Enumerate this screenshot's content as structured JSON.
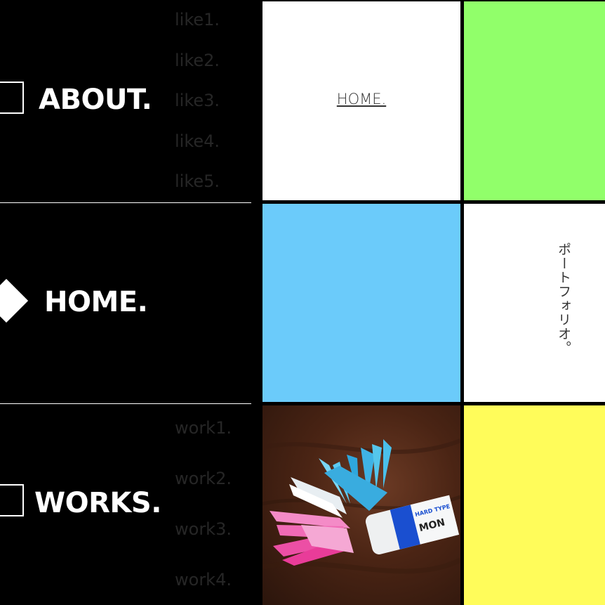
{
  "colors": {
    "background": "#000000",
    "nav_text": "#ffffff",
    "sub_text": "#262626",
    "green_tile": "#91ff6a",
    "blue_tile": "#6bcbfa",
    "yellow_tile": "#fffc5a",
    "white_tile": "#ffffff"
  },
  "nav": {
    "about": {
      "label": "ABOUT.",
      "icon": "square-outline-icon",
      "items": [
        "like1.",
        "like2.",
        "like3.",
        "like4.",
        "like5."
      ]
    },
    "home": {
      "label": "HOME.",
      "icon": "diamond-icon"
    },
    "works": {
      "label": "WORKS.",
      "icon": "square-outline-icon",
      "items": [
        "work1.",
        "work2.",
        "work3.",
        "work4."
      ]
    }
  },
  "tiles": {
    "home_link": "HOME.",
    "portfolio_text": "ポートフォリオ。",
    "photo_label": "HARD TYPE",
    "photo_brand": "MON"
  }
}
